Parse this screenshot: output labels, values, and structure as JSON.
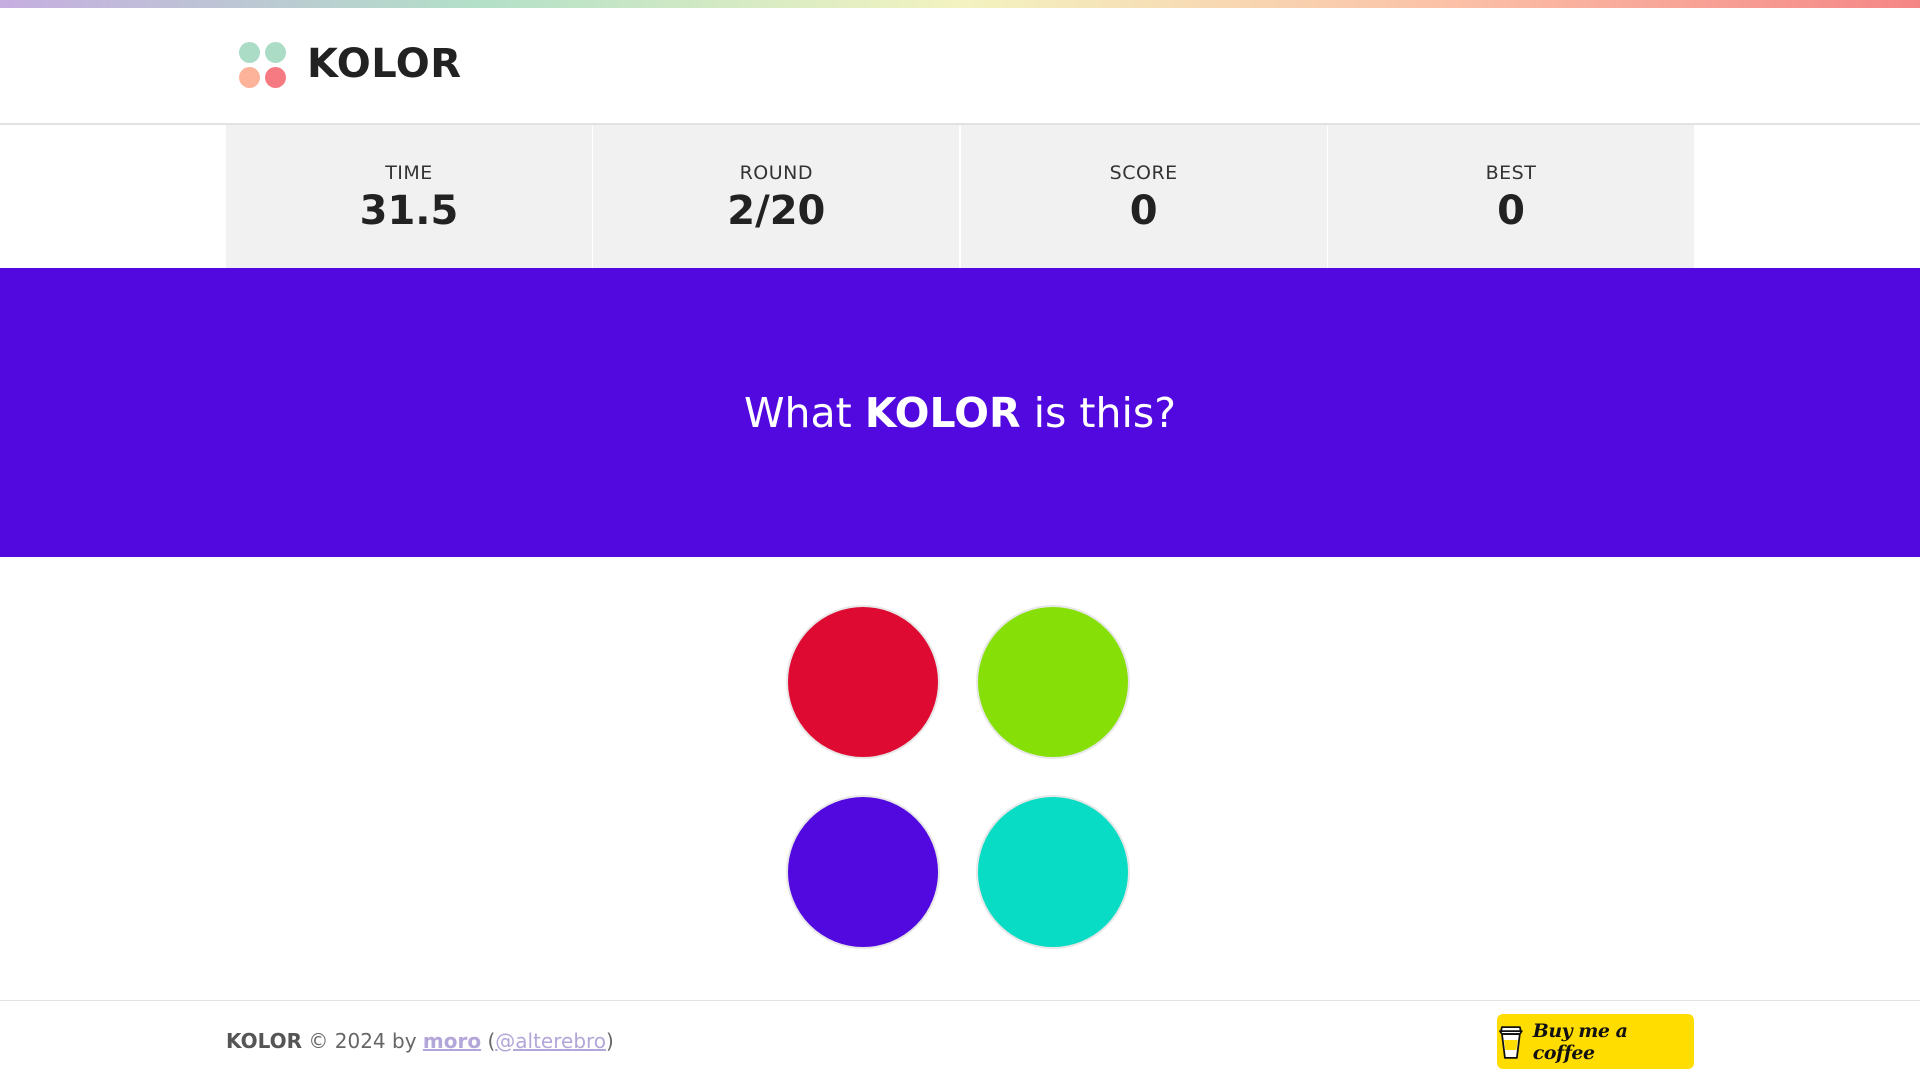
{
  "colors": {
    "rainbow": [
      "#c6aee0",
      "#b3e0c8",
      "#f3f3c0",
      "#fbc2a8",
      "#f58686"
    ],
    "logo_dots": [
      "#aadcc6",
      "#aadcc6",
      "#fdb29a",
      "#f67a82"
    ],
    "prompt_background": "#5109e0",
    "coffee_button": "#ffdd00"
  },
  "header": {
    "logo_text": "KOLOR"
  },
  "stats": [
    {
      "label": "TIME",
      "value": "31.5"
    },
    {
      "label": "ROUND",
      "value": "2/20"
    },
    {
      "label": "SCORE",
      "value": "0"
    },
    {
      "label": "BEST",
      "value": "0"
    }
  ],
  "prompt": {
    "prefix": "What ",
    "emphasis": "KOLOR",
    "suffix": " is this?"
  },
  "choices": [
    {
      "color": "#df0a32"
    },
    {
      "color": "#86df06"
    },
    {
      "color": "#5109e0"
    },
    {
      "color": "#08dcc4"
    }
  ],
  "footer": {
    "brand": "KOLOR",
    "copyright": " © 2024 by ",
    "author": "moro",
    "open_paren": " (",
    "handle": "@alterebro",
    "close_paren": ")",
    "coffee_label": "Buy me a coffee",
    "coffee_icon": "coffee-cup-icon"
  }
}
